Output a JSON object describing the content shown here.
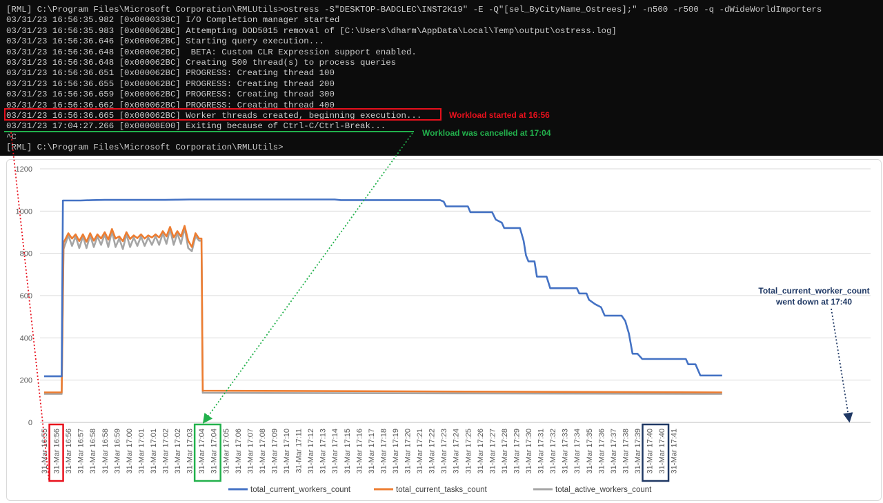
{
  "console": {
    "lines": [
      "[RML] C:\\Program Files\\Microsoft Corporation\\RMLUtils>ostress -S\"DESKTOP-BADCLEC\\INST2K19\" -E -Q\"[sel_ByCityName_Ostrees];\" -n500 -r500 -q -dWideWorldImporters",
      "03/31/23 16:56:35.982 [0x0000338C] I/O Completion manager started",
      "03/31/23 16:56:35.983 [0x000062BC] Attempting DOD5015 removal of [C:\\Users\\dharm\\AppData\\Local\\Temp\\output\\ostress.log]",
      "03/31/23 16:56:36.646 [0x000062BC] Starting query execution...",
      "03/31/23 16:56:36.648 [0x000062BC]  BETA: Custom CLR Expression support enabled.",
      "03/31/23 16:56:36.648 [0x000062BC] Creating 500 thread(s) to process queries",
      "03/31/23 16:56:36.651 [0x000062BC] PROGRESS: Creating thread 100",
      "03/31/23 16:56:36.655 [0x000062BC] PROGRESS: Creating thread 200",
      "03/31/23 16:56:36.659 [0x000062BC] PROGRESS: Creating thread 300",
      "03/31/23 16:56:36.662 [0x000062BC] PROGRESS: Creating thread 400",
      "03/31/23 16:56:36.665 [0x000062BC] Worker threads created, beginning execution...",
      "03/31/23 17:04:27.266 [0x00008E00] Exiting because of Ctrl-C/Ctrl-Break...",
      "^C",
      "[RML] C:\\Program Files\\Microsoft Corporation\\RMLUtils>"
    ]
  },
  "annotations": {
    "started": "Workload started at 16:56",
    "cancelled": "Workload was cancelled at 17:04",
    "went_down_line1": "Total_current_worker_count",
    "went_down_line2": "went down at 17:40"
  },
  "colors": {
    "red": "#e8101c",
    "green": "#22b14c",
    "navy": "#1f3864",
    "series_workers": "#4472c4",
    "series_tasks": "#ed7d31",
    "series_active": "#a5a5a5"
  },
  "chart_data": {
    "type": "line",
    "title": "",
    "xlabel": "",
    "ylabel": "",
    "ylim": [
      0,
      1200
    ],
    "yticks": [
      0,
      200,
      400,
      600,
      800,
      1000,
      1200
    ],
    "grid": true,
    "legend_position": "bottom",
    "categories": [
      "31-Mar 16:55",
      "31-Mar 16:56",
      "31-Mar 16:56",
      "31-Mar 16:57",
      "31-Mar 16:58",
      "31-Mar 16:58",
      "31-Mar 16:59",
      "31-Mar 17:00",
      "31-Mar 17:01",
      "31-Mar 17:01",
      "31-Mar 17:02",
      "31-Mar 17:02",
      "31-Mar 17:03",
      "31-Mar 17:04",
      "31-Mar 17:04",
      "31-Mar 17:05",
      "31-Mar 17:06",
      "31-Mar 17:07",
      "31-Mar 17:08",
      "31-Mar 17:09",
      "31-Mar 17:10",
      "31-Mar 17:11",
      "31-Mar 17:12",
      "31-Mar 17:13",
      "31-Mar 17:14",
      "31-Mar 17:15",
      "31-Mar 17:16",
      "31-Mar 17:17",
      "31-Mar 17:18",
      "31-Mar 17:19",
      "31-Mar 17:20",
      "31-Mar 17:21",
      "31-Mar 17:22",
      "31-Mar 17:23",
      "31-Mar 17:24",
      "31-Mar 17:25",
      "31-Mar 17:26",
      "31-Mar 17:27",
      "31-Mar 17:28",
      "31-Mar 17:29",
      "31-Mar 17:30",
      "31-Mar 17:31",
      "31-Mar 17:32",
      "31-Mar 17:33",
      "31-Mar 17:34",
      "31-Mar 17:35",
      "31-Mar 17:36",
      "31-Mar 17:37",
      "31-Mar 17:38",
      "31-Mar 17:39",
      "31-Mar 17:40",
      "31-Mar 17:40",
      "31-Mar 17:41"
    ],
    "highlight_boxes": [
      {
        "label": "started",
        "from_index": 1,
        "to_index": 1,
        "color": "red"
      },
      {
        "label": "cancelled",
        "from_index": 13,
        "to_index": 14,
        "color": "green"
      },
      {
        "label": "went_down",
        "from_index": 50,
        "to_index": 51,
        "color": "navy"
      }
    ],
    "series": [
      {
        "name": "total_current_workers_count",
        "color": "#4472c4",
        "points": [
          [
            0,
            218
          ],
          [
            1.45,
            218
          ],
          [
            1.55,
            1050
          ],
          [
            2,
            1050
          ],
          [
            3,
            1050
          ],
          [
            4,
            1052
          ],
          [
            5,
            1053
          ],
          [
            10,
            1053
          ],
          [
            11,
            1054
          ],
          [
            12,
            1055
          ],
          [
            20,
            1055
          ],
          [
            24,
            1055
          ],
          [
            24.5,
            1052
          ],
          [
            30,
            1052
          ],
          [
            32.7,
            1052
          ],
          [
            33,
            1045
          ],
          [
            33.2,
            1022
          ],
          [
            35,
            1022
          ],
          [
            35.2,
            995
          ],
          [
            37,
            995
          ],
          [
            37.3,
            960
          ],
          [
            37.8,
            945
          ],
          [
            38,
            920
          ],
          [
            39.3,
            920
          ],
          [
            39.6,
            860
          ],
          [
            39.8,
            790
          ],
          [
            40,
            762
          ],
          [
            40.5,
            762
          ],
          [
            40.7,
            690
          ],
          [
            41.5,
            690
          ],
          [
            41.8,
            635
          ],
          [
            44,
            635
          ],
          [
            44.2,
            610
          ],
          [
            44.8,
            610
          ],
          [
            45,
            580
          ],
          [
            45.5,
            560
          ],
          [
            46,
            545
          ],
          [
            46.3,
            505
          ],
          [
            47.7,
            505
          ],
          [
            48,
            480
          ],
          [
            48.3,
            420
          ],
          [
            48.6,
            325
          ],
          [
            49,
            325
          ],
          [
            49.4,
            300
          ],
          [
            50,
            300
          ],
          [
            53,
            300
          ],
          [
            53.2,
            275
          ],
          [
            53.8,
            275
          ],
          [
            54.2,
            222
          ],
          [
            56,
            222
          ]
        ]
      },
      {
        "name": "total_current_tasks_count",
        "color": "#ed7d31",
        "points": [
          [
            0,
            142
          ],
          [
            1.45,
            142
          ],
          [
            1.6,
            850
          ],
          [
            2,
            895
          ],
          [
            2.3,
            870
          ],
          [
            2.6,
            890
          ],
          [
            2.9,
            858
          ],
          [
            3.2,
            890
          ],
          [
            3.5,
            855
          ],
          [
            3.8,
            895
          ],
          [
            4.1,
            860
          ],
          [
            4.4,
            890
          ],
          [
            4.7,
            870
          ],
          [
            5,
            900
          ],
          [
            5.3,
            865
          ],
          [
            5.6,
            915
          ],
          [
            5.9,
            870
          ],
          [
            6.2,
            880
          ],
          [
            6.5,
            858
          ],
          [
            6.8,
            900
          ],
          [
            7.1,
            868
          ],
          [
            7.4,
            885
          ],
          [
            7.7,
            872
          ],
          [
            8,
            890
          ],
          [
            8.3,
            870
          ],
          [
            8.6,
            885
          ],
          [
            8.9,
            875
          ],
          [
            9.2,
            890
          ],
          [
            9.5,
            875
          ],
          [
            9.8,
            905
          ],
          [
            10.1,
            880
          ],
          [
            10.4,
            925
          ],
          [
            10.7,
            875
          ],
          [
            11,
            905
          ],
          [
            11.3,
            880
          ],
          [
            11.6,
            930
          ],
          [
            11.9,
            860
          ],
          [
            12.2,
            830
          ],
          [
            12.5,
            895
          ],
          [
            12.8,
            870
          ],
          [
            13,
            870
          ],
          [
            13.1,
            150
          ],
          [
            56,
            142
          ]
        ]
      },
      {
        "name": "total_active_workers_count",
        "color": "#a5a5a5",
        "points": [
          [
            0,
            135
          ],
          [
            1.45,
            135
          ],
          [
            1.6,
            820
          ],
          [
            2,
            885
          ],
          [
            2.3,
            835
          ],
          [
            2.6,
            880
          ],
          [
            2.9,
            825
          ],
          [
            3.2,
            880
          ],
          [
            3.5,
            825
          ],
          [
            3.8,
            885
          ],
          [
            4.1,
            830
          ],
          [
            4.4,
            880
          ],
          [
            4.7,
            840
          ],
          [
            5,
            890
          ],
          [
            5.3,
            830
          ],
          [
            5.6,
            905
          ],
          [
            5.9,
            830
          ],
          [
            6.2,
            870
          ],
          [
            6.5,
            820
          ],
          [
            6.8,
            890
          ],
          [
            7.1,
            830
          ],
          [
            7.4,
            875
          ],
          [
            7.7,
            835
          ],
          [
            8,
            880
          ],
          [
            8.3,
            835
          ],
          [
            8.6,
            875
          ],
          [
            8.9,
            840
          ],
          [
            9.2,
            880
          ],
          [
            9.5,
            840
          ],
          [
            9.8,
            895
          ],
          [
            10.1,
            845
          ],
          [
            10.4,
            915
          ],
          [
            10.7,
            840
          ],
          [
            11,
            895
          ],
          [
            11.3,
            845
          ],
          [
            11.6,
            920
          ],
          [
            11.9,
            825
          ],
          [
            12.2,
            810
          ],
          [
            12.5,
            880
          ],
          [
            12.8,
            860
          ],
          [
            13,
            860
          ],
          [
            13.1,
            140
          ],
          [
            56,
            135
          ]
        ]
      }
    ]
  }
}
